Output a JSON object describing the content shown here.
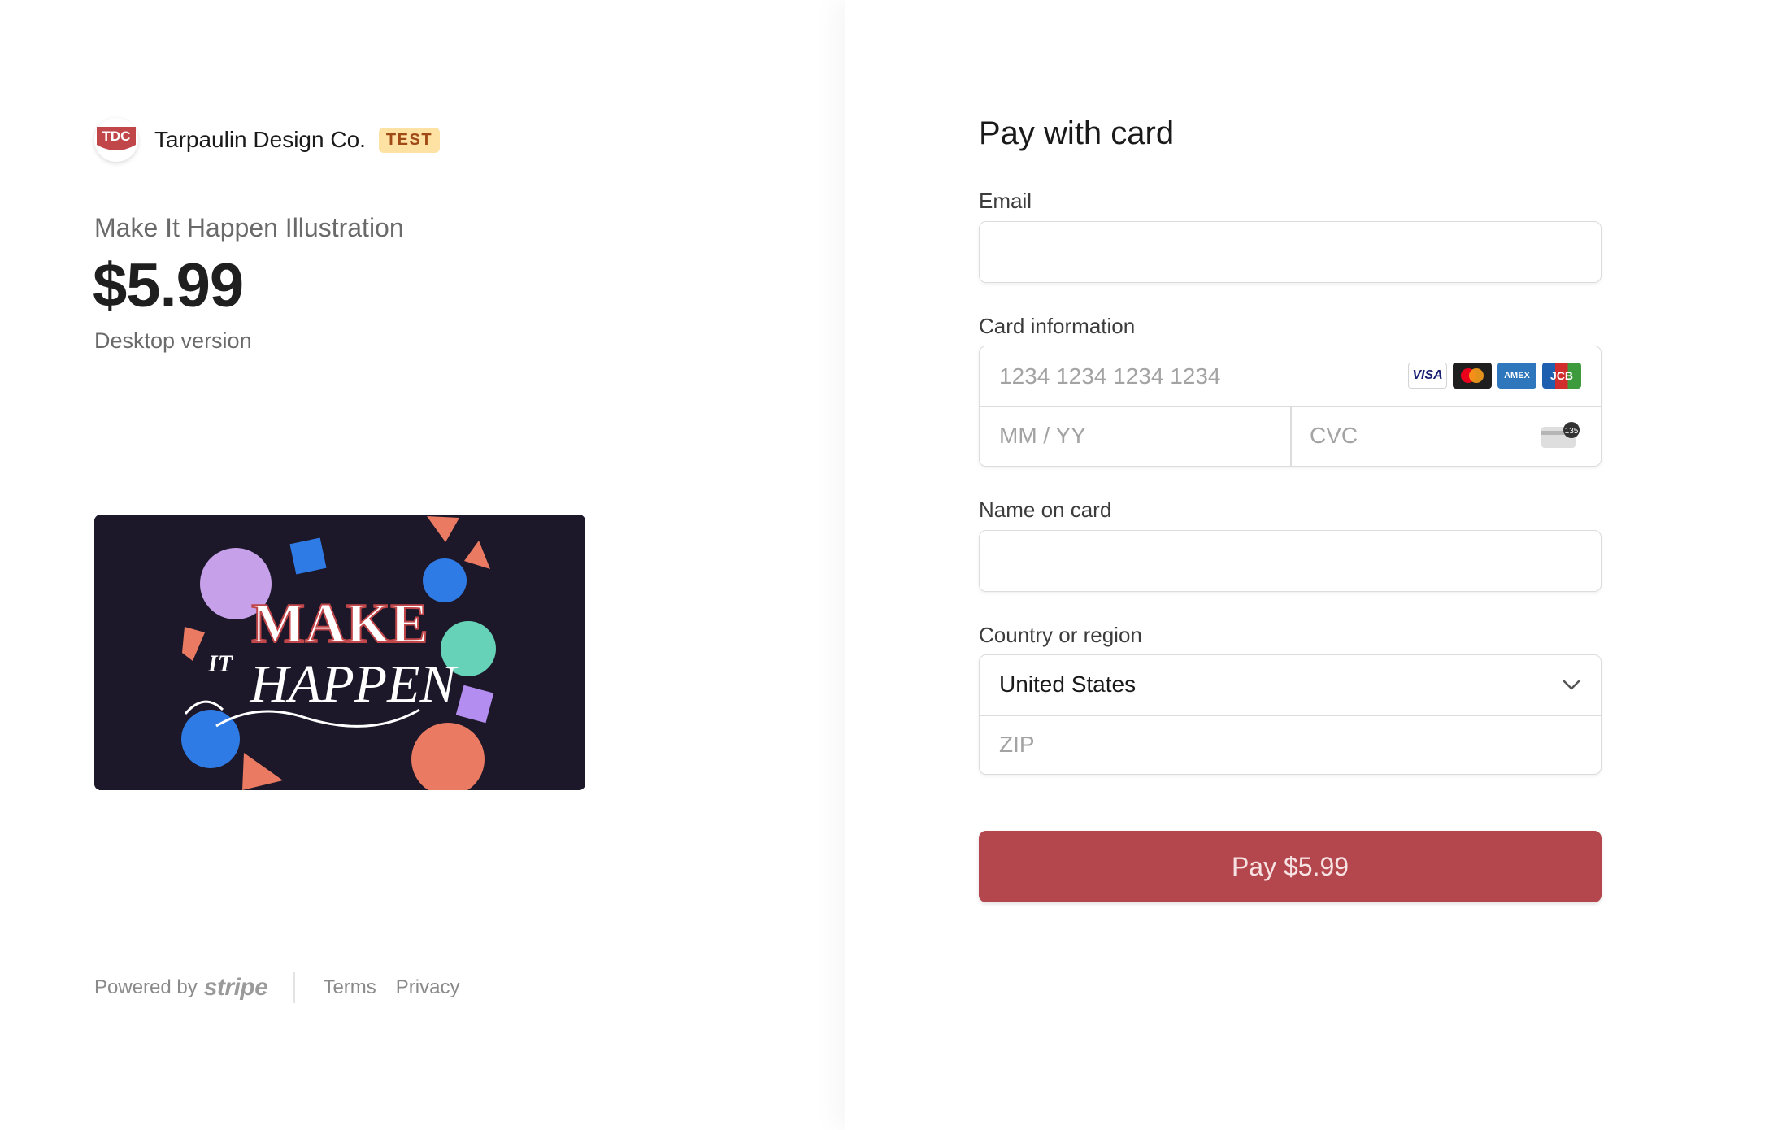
{
  "merchant": {
    "logo_text": "TDC",
    "name": "Tarpaulin Design Co.",
    "badge": "TEST"
  },
  "product": {
    "name": "Make It Happen Illustration",
    "price": "$5.99",
    "description": "Desktop version",
    "image_text_line1": "MAKE",
    "image_text_line2": "IT",
    "image_text_line3": "HAPPEN"
  },
  "footer": {
    "powered_by": "Powered by",
    "stripe": "stripe",
    "terms": "Terms",
    "privacy": "Privacy"
  },
  "form": {
    "title": "Pay with card",
    "email_label": "Email",
    "email_value": "",
    "card_label": "Card information",
    "card_number_placeholder": "1234 1234 1234 1234",
    "expiry_placeholder": "MM / YY",
    "cvc_placeholder": "CVC",
    "cvc_icon_text": "135",
    "card_brands": [
      "VISA",
      "mastercard",
      "AMEX",
      "JCB"
    ],
    "name_label": "Name on card",
    "name_value": "",
    "country_label": "Country or region",
    "country_value": "United States",
    "zip_placeholder": "ZIP",
    "pay_button": "Pay $5.99"
  },
  "colors": {
    "accent": "#b4474e",
    "badge_bg": "#fde2a4",
    "badge_text": "#a04a15",
    "image_bg": "#1c1829"
  }
}
